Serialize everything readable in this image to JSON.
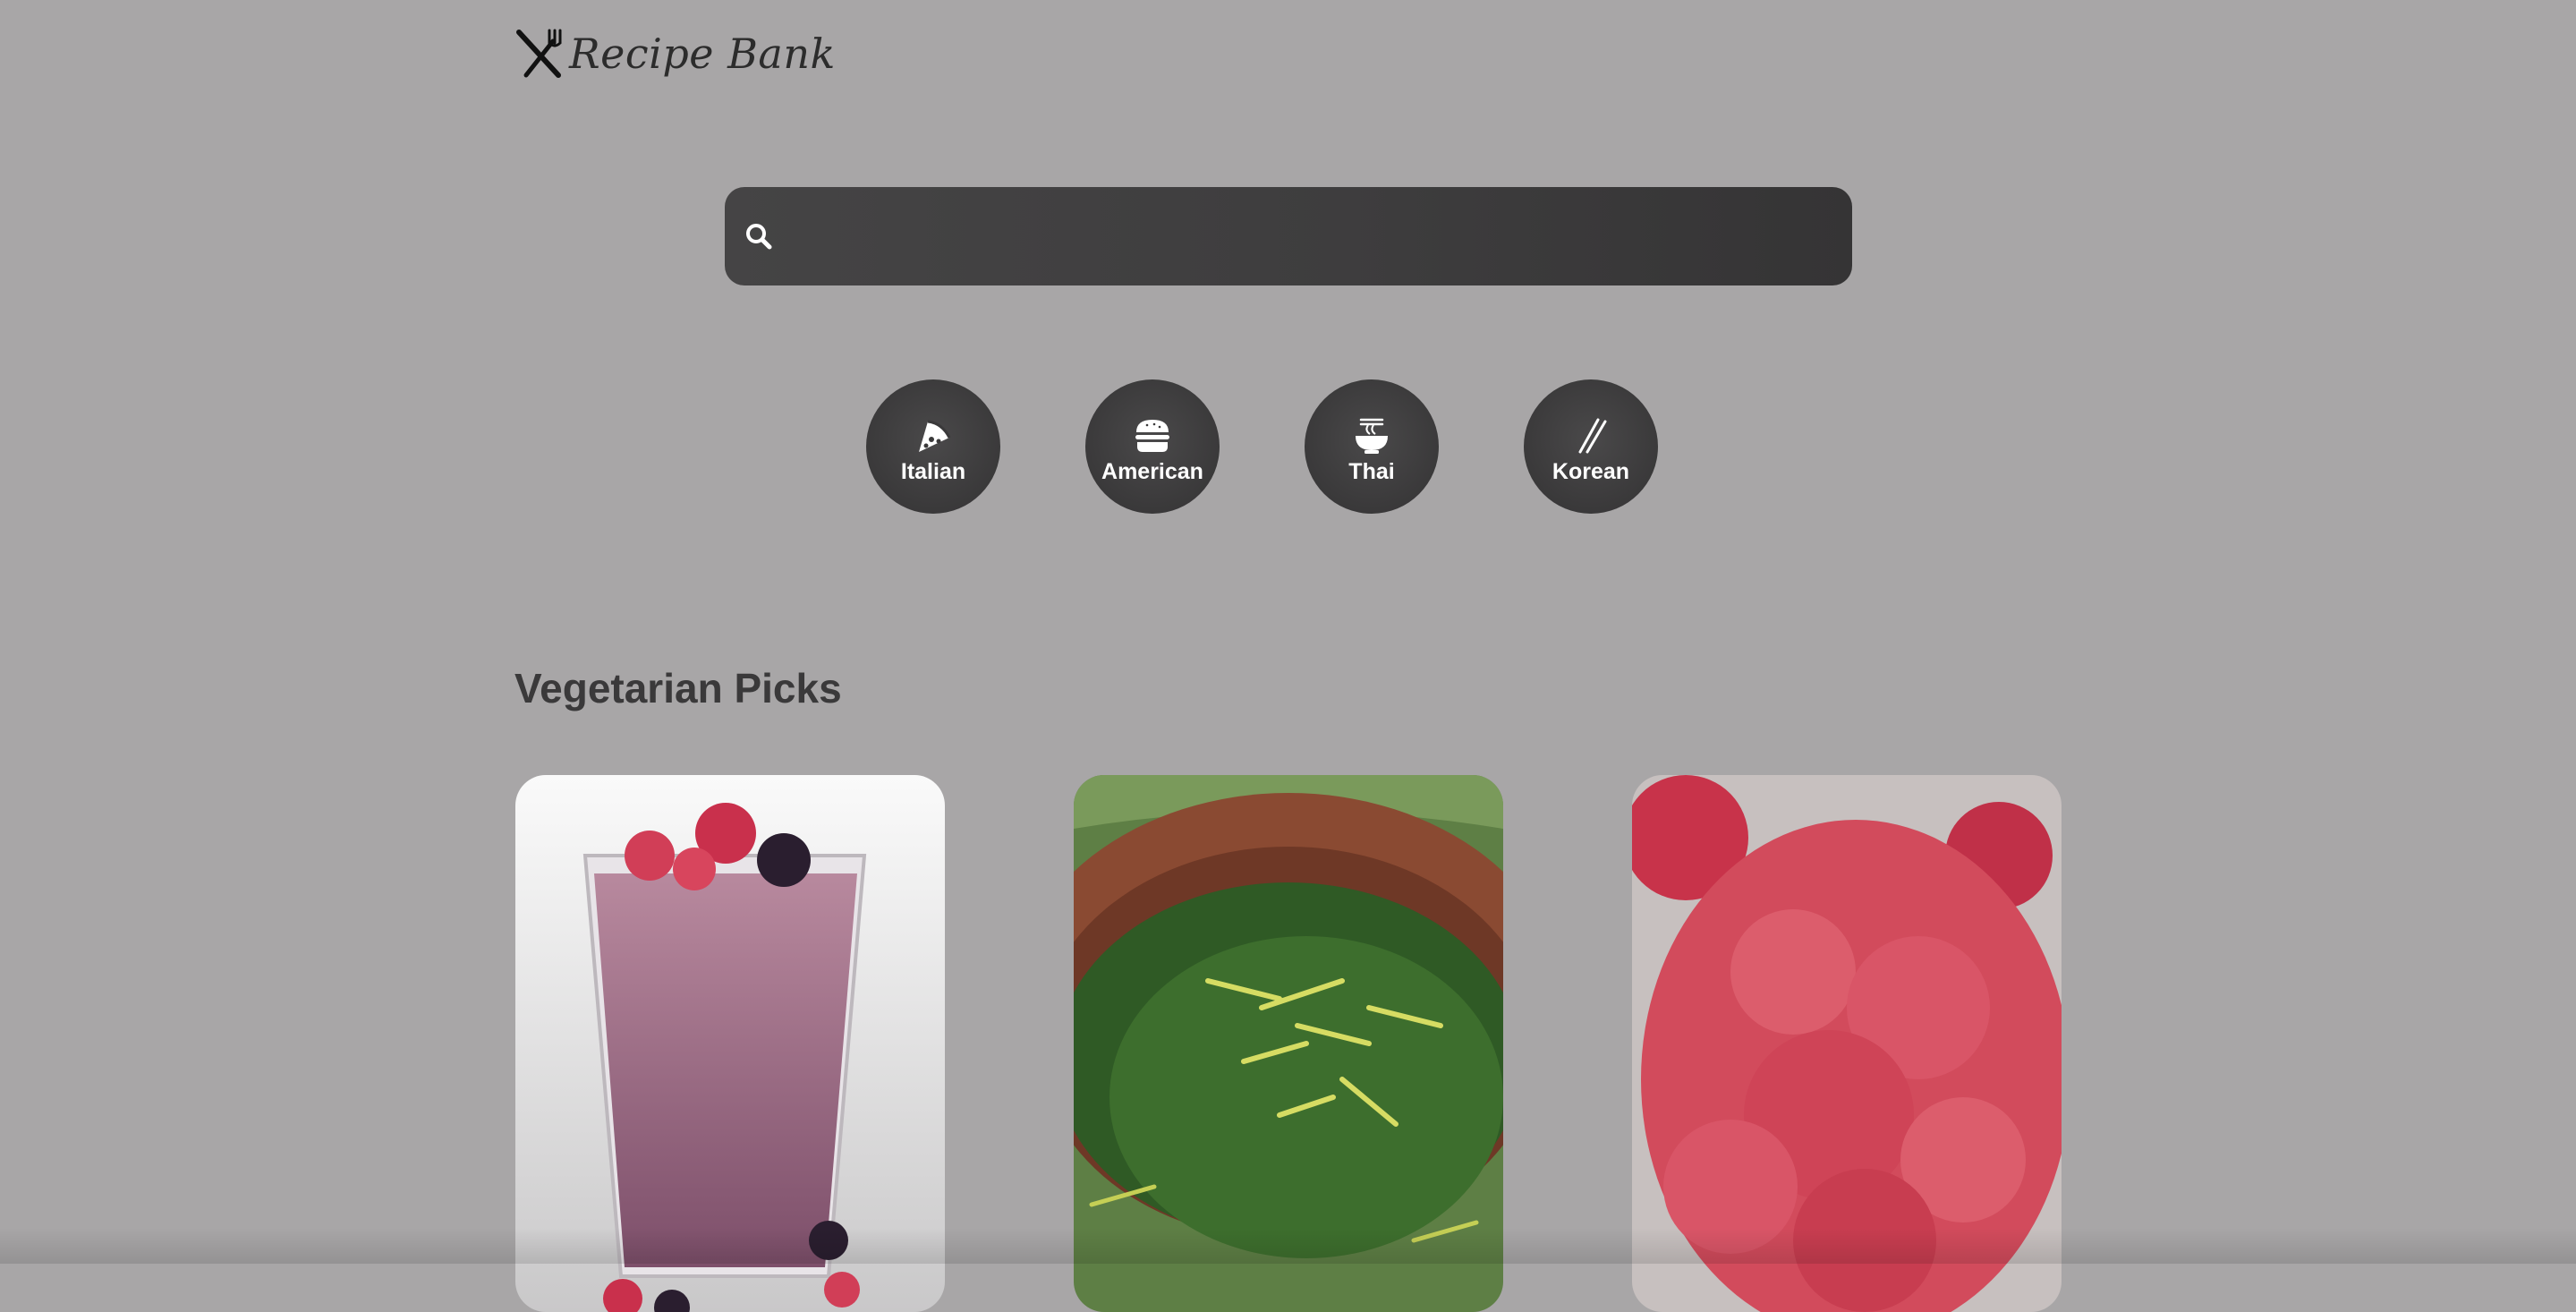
{
  "brand": {
    "name": "Recipe Bank",
    "logo_icon": "fork-knife-icon"
  },
  "search": {
    "icon": "search-icon",
    "value": "",
    "placeholder": ""
  },
  "cuisines": [
    {
      "label": "Italian",
      "icon": "pizza-icon"
    },
    {
      "label": "American",
      "icon": "burger-icon"
    },
    {
      "label": "Thai",
      "icon": "noodle-bowl-icon"
    },
    {
      "label": "Korean",
      "icon": "chopsticks-icon"
    }
  ],
  "section": {
    "title": "Vegetarian Picks"
  },
  "recipes": [
    {
      "image": "berry-smoothie-photo"
    },
    {
      "image": "green-herb-dish-photo"
    },
    {
      "image": "raspberry-sorbet-photo"
    }
  ],
  "colors": {
    "page_background": "#a8a6a7",
    "search_bar": "#3e3d3e",
    "category_circle": "#3a393a",
    "title_text": "#3a393a"
  }
}
